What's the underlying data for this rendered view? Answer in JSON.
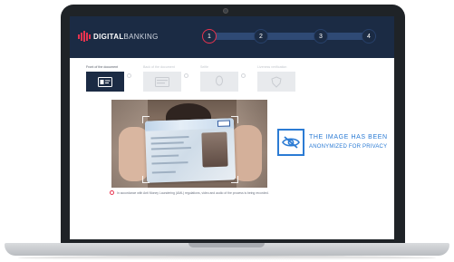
{
  "brand": {
    "name_bold": "DIGITAL",
    "name_light": "BANKING",
    "accent_color": "#e8334f",
    "header_color": "#1b2b44"
  },
  "stepper": {
    "steps": [
      "1",
      "2",
      "3",
      "4"
    ],
    "active_step": 1
  },
  "document_tabs": [
    {
      "label": "Front of the document",
      "icon": "id-card-icon",
      "state": "active"
    },
    {
      "label": "Back of the document",
      "icon": "id-card-back-icon",
      "state": "pending"
    },
    {
      "label": "Selfie",
      "icon": "person-icon",
      "state": "pending"
    },
    {
      "label": "Liveness verification",
      "icon": "shield-icon",
      "state": "pending"
    }
  ],
  "camera_preview": {
    "icon": "camera-preview"
  },
  "privacy_notice": {
    "line1": "THE IMAGE HAS BEEN",
    "line2": "ANONYMIZED FOR PRIVACY",
    "icon": "eye-slash-icon",
    "color": "#2b7bd4"
  },
  "footnote": {
    "icon": "record-icon",
    "text": "In accordance with Anti Money Laundering (AML) regulations, video and audio of the process is being recorded."
  }
}
